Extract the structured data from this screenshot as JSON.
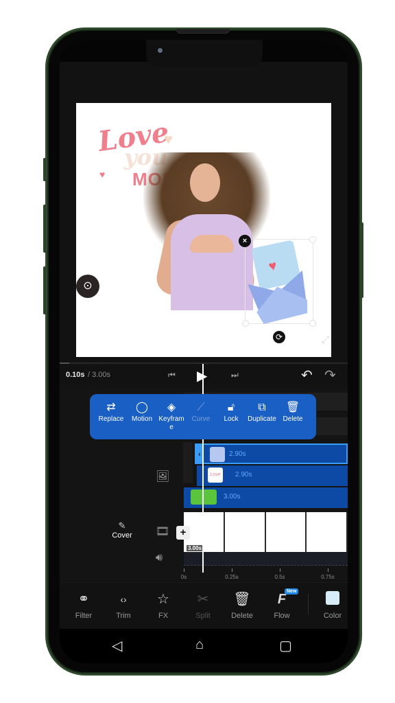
{
  "playback": {
    "current_time": "0.10s",
    "separator": " / ",
    "total_time": "3.00s",
    "progress_fraction": 0.033,
    "prev_icon": "skip-previous-icon",
    "play_icon": "play-icon",
    "next_icon": "skip-next-icon",
    "undo_icon": "undo-icon",
    "redo_icon": "redo-icon"
  },
  "canvas": {
    "sticker_text": {
      "line1": "Love",
      "line2": "you",
      "line3": "MOM"
    },
    "selected_sticker": "love-letter-envelope",
    "close_icon": "×",
    "rotate_icon": "⟳",
    "expand_icon": "⤢",
    "lens_icon": "⊙"
  },
  "context_menu": {
    "items": [
      {
        "label": "Replace",
        "icon": "⇄",
        "disabled": false
      },
      {
        "label": "Motion",
        "icon": "◯",
        "disabled": false
      },
      {
        "label": "Keyframe",
        "icon": "◈",
        "disabled": false
      },
      {
        "label": "Curve",
        "icon": "⟋",
        "disabled": true
      },
      {
        "label": "Lock",
        "icon": "🔓︎",
        "disabled": false
      },
      {
        "label": "Duplicate",
        "icon": "⧉",
        "disabled": false
      },
      {
        "label": "Delete",
        "icon": "🗑︎",
        "disabled": false
      }
    ]
  },
  "timeline": {
    "clips": [
      {
        "duration": "2.90s",
        "type": "sticker-envelope",
        "selected": true
      },
      {
        "duration": "2.90s",
        "type": "sticker-love-you-mom",
        "selected": false
      },
      {
        "duration": "3.00s",
        "type": "photo-woman",
        "selected": false
      }
    ],
    "video_duration": "3.00s",
    "cover_label": "Cover",
    "add_clip_label": "+",
    "ruler": [
      "0s",
      "0.25s",
      "0.5s",
      "0.75s"
    ]
  },
  "toolbar": {
    "items": [
      {
        "label": "Filter",
        "icon": "⚭",
        "disabled": false
      },
      {
        "label": "Trim",
        "icon": "‹›",
        "disabled": false
      },
      {
        "label": "FX",
        "icon": "☆",
        "disabled": false
      },
      {
        "label": "Split",
        "icon": "✂",
        "disabled": true
      },
      {
        "label": "Delete",
        "icon": "🗑︎",
        "disabled": false
      },
      {
        "label": "Flow",
        "icon": "F",
        "disabled": false,
        "badge": "New"
      },
      {
        "label": "Color",
        "icon": "color-swatch",
        "disabled": false,
        "swatch": "#d7ecf7"
      }
    ]
  },
  "navbar": {
    "back": "◁",
    "home": "⌂",
    "recents": "▢"
  },
  "colors": {
    "accent": "#1a5fc4",
    "clip": "#0d4aa6",
    "selected_border": "#3a9cf5",
    "text_pink": "#ef7f8c"
  }
}
